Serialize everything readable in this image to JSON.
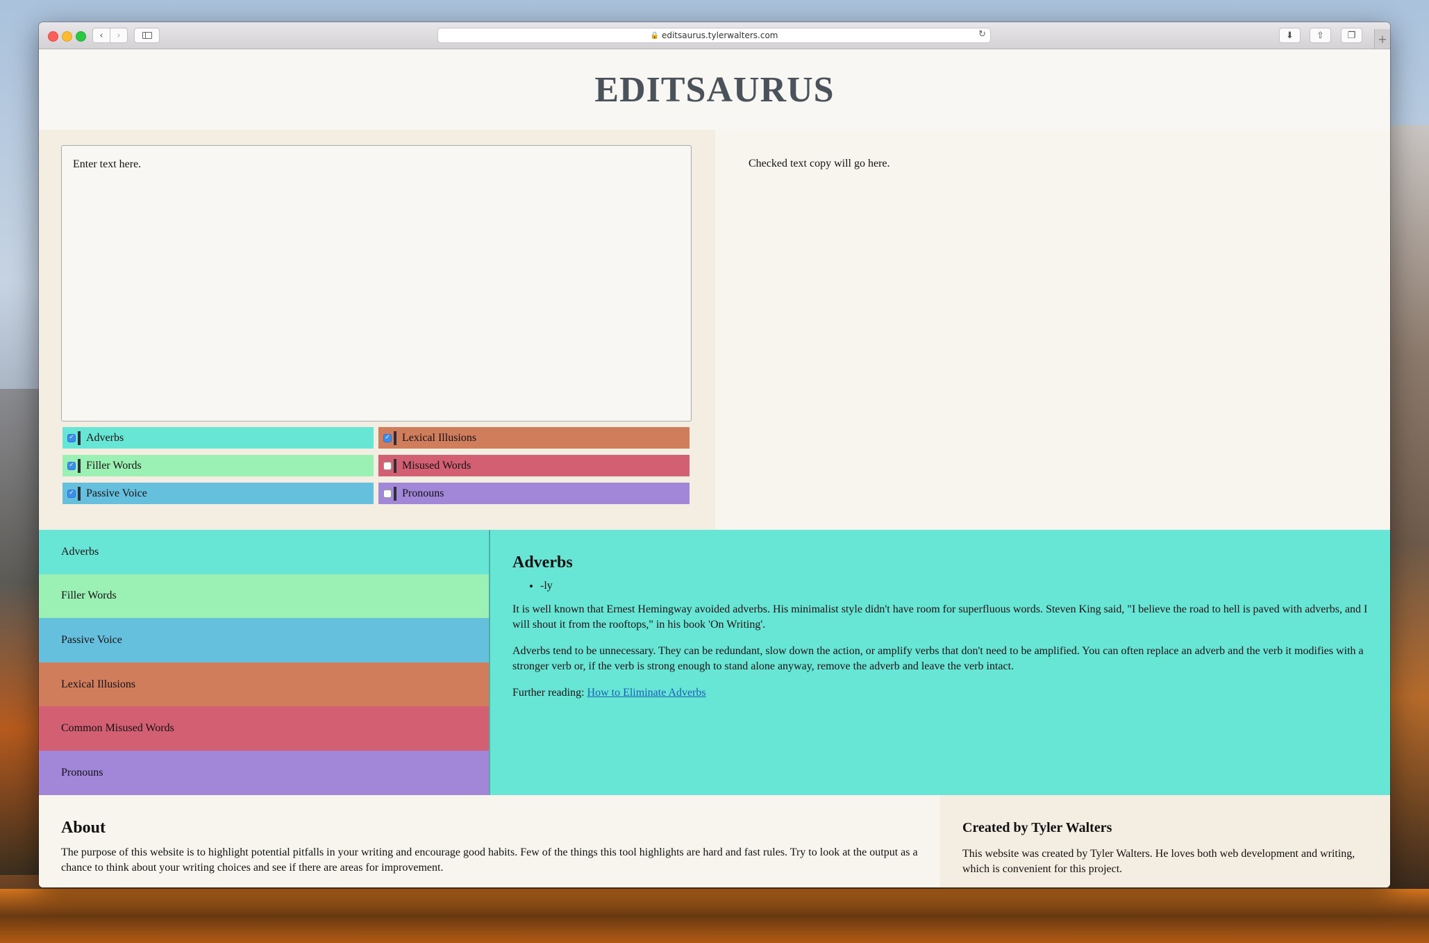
{
  "browser": {
    "url": "editsaurus.tylerwalters.com"
  },
  "header": {
    "title": "EDITSAURUS"
  },
  "editor": {
    "placeholder": "Enter text here.",
    "output_placeholder": "Checked text copy will go here."
  },
  "options": [
    {
      "label": "Adverbs",
      "checked": true,
      "color": "#67e6d6"
    },
    {
      "label": "Lexical Illusions",
      "checked": true,
      "color": "#d07d5c"
    },
    {
      "label": "Filler Words",
      "checked": true,
      "color": "#9bf0b4"
    },
    {
      "label": "Misused Words",
      "checked": false,
      "color": "#d35f73"
    },
    {
      "label": "Passive Voice",
      "checked": true,
      "color": "#64c0dc"
    },
    {
      "label": "Pronouns",
      "checked": false,
      "color": "#a287d8"
    }
  ],
  "tabs": [
    {
      "label": "Adverbs",
      "color": "#67e6d6"
    },
    {
      "label": "Filler Words",
      "color": "#9bf0b4"
    },
    {
      "label": "Passive Voice",
      "color": "#64c0dc"
    },
    {
      "label": "Lexical Illusions",
      "color": "#d07d5c"
    },
    {
      "label": "Common Misused Words",
      "color": "#d35f73"
    },
    {
      "label": "Pronouns",
      "color": "#a287d8"
    }
  ],
  "tab_content": {
    "title": "Adverbs",
    "bullets": [
      "-ly"
    ],
    "paragraph1": "It is well known that Ernest Hemingway avoided adverbs. His minimalist style didn't have room for superfluous words. Steven King said, \"I believe the road to hell is paved with adverbs, and I will shout it from the rooftops,\" in his book 'On Writing'.",
    "paragraph2": "Adverbs tend to be unnecessary. They can be redundant, slow down the action, or amplify verbs that don't need to be amplified. You can often replace an adverb and the verb it modifies with a stronger verb or, if the verb is strong enough to stand alone anyway, remove the adverb and leave the verb intact.",
    "further_label": "Further reading: ",
    "further_link": "How to Eliminate Adverbs"
  },
  "about": {
    "title": "About",
    "text": "The purpose of this website is to highlight potential pitfalls in your writing and encourage good habits. Few of the things this tool highlights are hard and fast rules. Try to look at the output as a chance to think about your writing choices and see if there are areas for improvement."
  },
  "credit": {
    "title": "Created by Tyler Walters",
    "text": "This website was created by Tyler Walters. He loves both web development and writing, which is convenient for this project."
  }
}
